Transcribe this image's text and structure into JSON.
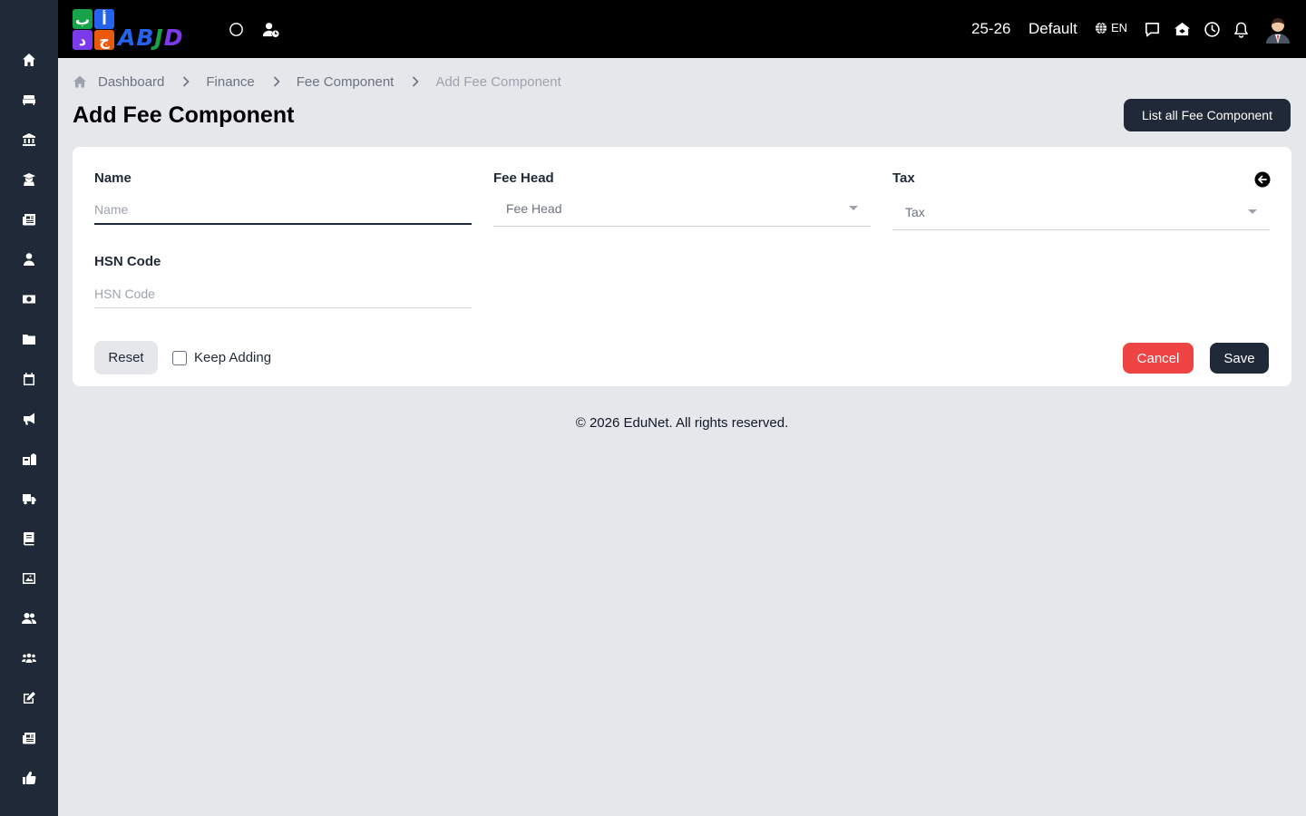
{
  "app": {
    "logo_text": "ABJD",
    "logo_tiles": [
      "ب",
      "أ",
      "ﺩ",
      "ج"
    ]
  },
  "topbar": {
    "session": "25-26",
    "profile": "Default",
    "language": "EN",
    "icons": [
      "circle-icon",
      "user-clock-icon",
      "globe-icon",
      "chat-icon",
      "school-icon",
      "clock-icon",
      "bell-icon",
      "avatar"
    ]
  },
  "sidebar": {
    "items": [
      {
        "icon": "home-icon"
      },
      {
        "icon": "sofa-icon"
      },
      {
        "icon": "institution-icon"
      },
      {
        "icon": "graduate-icon"
      },
      {
        "icon": "newspaper-icon"
      },
      {
        "icon": "user-tie-icon"
      },
      {
        "icon": "money-bill-icon"
      },
      {
        "icon": "folder-icon"
      },
      {
        "icon": "calendar-icon"
      },
      {
        "icon": "megaphone-icon"
      },
      {
        "icon": "school-flag-icon"
      },
      {
        "icon": "truck-icon"
      },
      {
        "icon": "book-icon"
      },
      {
        "icon": "image-icon"
      },
      {
        "icon": "users-icon"
      },
      {
        "icon": "people-group-icon"
      },
      {
        "icon": "edit-icon"
      },
      {
        "icon": "news-icon"
      },
      {
        "icon": "thumbs-up-icon"
      }
    ]
  },
  "breadcrumb": {
    "items": [
      "Dashboard",
      "Finance",
      "Fee Component",
      "Add Fee Component"
    ]
  },
  "page": {
    "title": "Add Fee Component",
    "list_button": "List all Fee Component"
  },
  "form": {
    "name": {
      "label": "Name",
      "placeholder": "Name",
      "value": ""
    },
    "fee_head": {
      "label": "Fee Head",
      "selected": "Fee Head"
    },
    "tax": {
      "label": "Tax",
      "selected": "Tax"
    },
    "hsn_code": {
      "label": "HSN Code",
      "placeholder": "HSN Code",
      "value": ""
    },
    "reset_label": "Reset",
    "keep_adding_label": "Keep Adding",
    "keep_adding_checked": false,
    "cancel_label": "Cancel",
    "save_label": "Save"
  },
  "footer": {
    "text": "© 2026 EduNet. All rights reserved."
  },
  "colors": {
    "sidebar": "#1f2937",
    "topbar": "#000000",
    "primary_button": "#1f2937",
    "cancel_button": "#ef4444",
    "page_bg": "#e5e7eb"
  }
}
